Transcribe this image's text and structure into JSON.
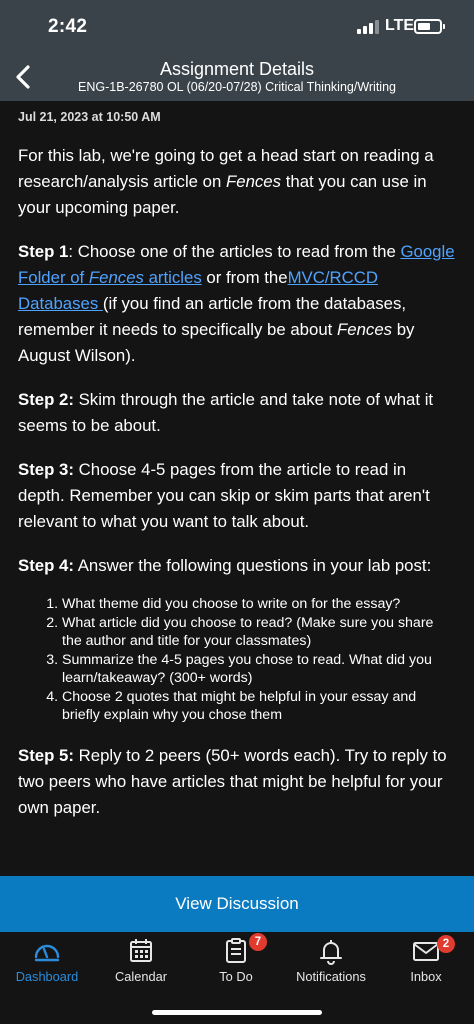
{
  "status_bar": {
    "time": "2:42",
    "network": "LTE"
  },
  "header": {
    "title": "Assignment Details",
    "subtitle": "ENG-1B-26780 OL (06/20-07/28) Critical Thinking/Writing"
  },
  "content": {
    "date": "Jul 21, 2023 at 10:50 AM",
    "intro": {
      "before": "For this lab, we're going to get a head start on reading a research/analysis article on ",
      "italic": "Fences",
      "after": " that you can use in your upcoming paper."
    },
    "step1": {
      "label": "Step 1",
      "text1": ": Choose one of the articles to read from the ",
      "link1_pre": "Google Folder of ",
      "link1_italic": "Fences",
      "link1_post": " articles",
      "text2": " or from the",
      "link2": "MVC/RCCD Databases ",
      "text3": "(if you find an article from the databases, remember it needs to specifically be about ",
      "italic": "Fences",
      "text4": " by August Wilson)."
    },
    "step2": {
      "label": "Step 2:",
      "text": " Skim through the article and take note of what it seems to be about."
    },
    "step3": {
      "label": "Step 3:",
      "text": " Choose 4-5 pages from the article to read in depth. Remember you can skip or skim parts that aren't relevant to what you want to talk about."
    },
    "step4": {
      "label": "Step 4:",
      "text": " Answer the following questions in your lab post:"
    },
    "questions": [
      "What theme did you choose to write on for the essay?",
      "What article did you choose to read? (Make sure you share the author and title for your classmates)",
      "Summarize the 4-5 pages you chose to read. What did you learn/takeaway? (300+ words)",
      "Choose 2 quotes that might be helpful in your essay and briefly explain why you chose them"
    ],
    "step5": {
      "label": "Step 5:",
      "text": " Reply to 2 peers (50+ words each). Try to reply to two peers who have articles that might be helpful for your own paper."
    }
  },
  "view_discussion": "View Discussion",
  "tabs": [
    {
      "label": "Dashboard",
      "icon": "dashboard-icon",
      "active": true
    },
    {
      "label": "Calendar",
      "icon": "calendar-icon"
    },
    {
      "label": "To Do",
      "icon": "todo-icon",
      "badge": "7"
    },
    {
      "label": "Notifications",
      "icon": "bell-icon"
    },
    {
      "label": "Inbox",
      "icon": "inbox-icon",
      "badge": "2"
    }
  ],
  "colors": {
    "header": "#3a4349",
    "accent": "#0b7bc1",
    "link": "#4fa3ff",
    "badge": "#e03b2e",
    "active_tab": "#2a8cdb"
  }
}
